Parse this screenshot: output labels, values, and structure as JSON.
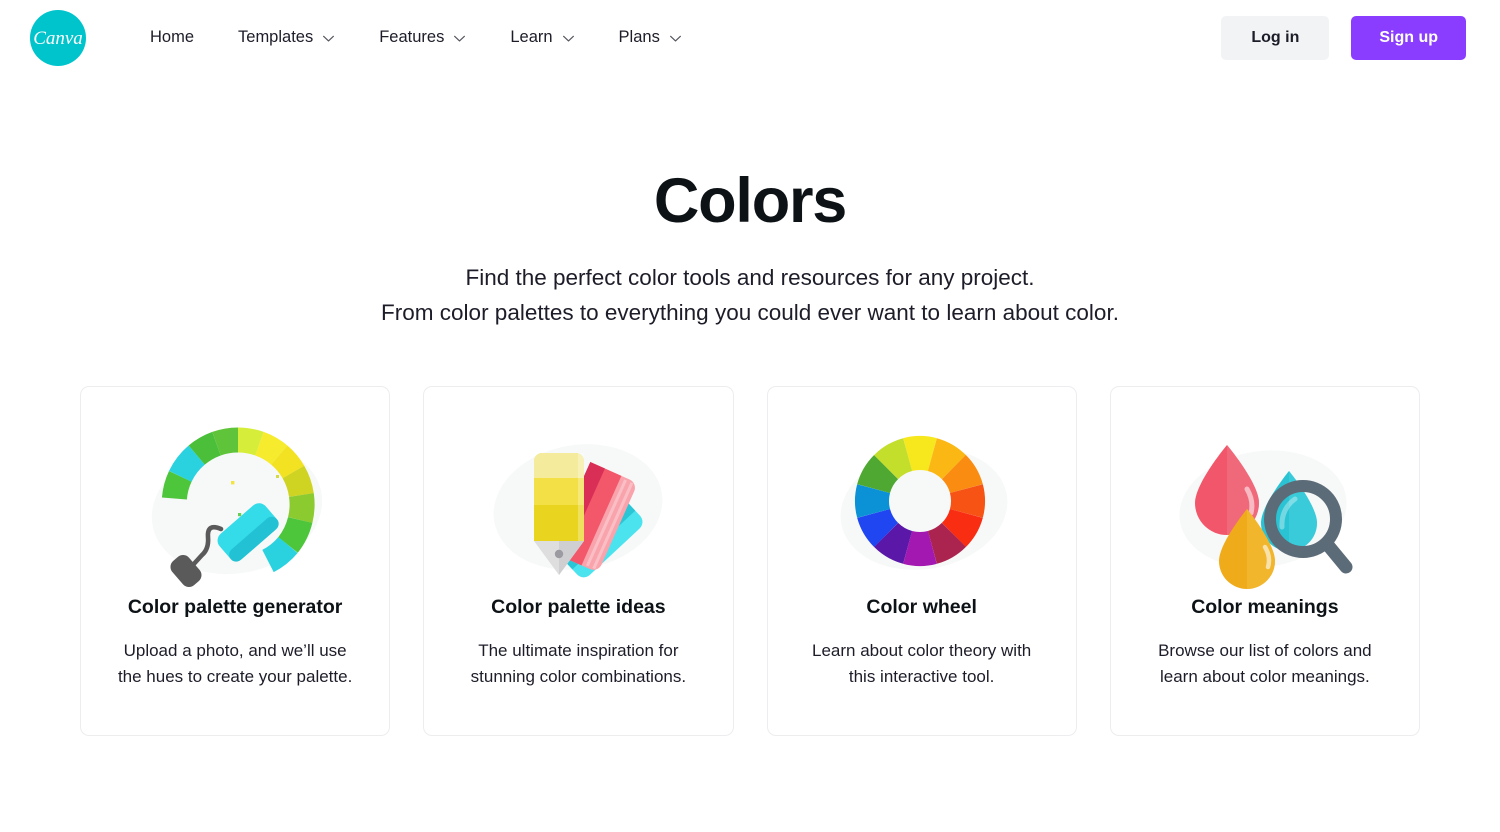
{
  "header": {
    "logo": {
      "name": "canva-logo",
      "wordmark": "Canva",
      "color": "#00c4cc"
    },
    "nav": [
      {
        "label": "Home",
        "has_dropdown": false
      },
      {
        "label": "Templates",
        "has_dropdown": true
      },
      {
        "label": "Features",
        "has_dropdown": true
      },
      {
        "label": "Learn",
        "has_dropdown": true
      },
      {
        "label": "Plans",
        "has_dropdown": true
      }
    ],
    "login_label": "Log in",
    "signup_label": "Sign up",
    "login_bg": "#f2f3f5",
    "signup_bg": "#8b3dff"
  },
  "hero": {
    "title": "Colors",
    "subtitle_line1": "Find the perfect color tools and resources for any project.",
    "subtitle_line2": "From color palettes to everything you could ever want to learn about color."
  },
  "cards": [
    {
      "icon": "paint-roller-color-arc-illustration",
      "title": "Color palette generator",
      "description": "Upload a photo, and we’ll use the hues to create your palette.",
      "arc_colors": [
        "#4ec63c",
        "#2ad2e0",
        "#4bbf3a",
        "#5fc43a",
        "#d6ee3a",
        "#f6eb2c",
        "#f2e221",
        "#cfd322",
        "#8ccb2f",
        "#4ec63c",
        "#2ad2e0"
      ],
      "roller_color": "#2ad2e0",
      "handle_color": "#5a5a5a"
    },
    {
      "icon": "color-swatch-fan-illustration",
      "title": "Color palette ideas",
      "description": "The ultimate inspiration for stunning color combinations.",
      "swatch_colors": [
        "#f5e03a",
        "#f2574f",
        "#2ad2e0"
      ],
      "tip_color": "#d8d8d8"
    },
    {
      "icon": "color-wheel-illustration",
      "title": "Color wheel",
      "description": "Learn about color theory with this interactive tool.",
      "wheel_segments": [
        "#f7e81e",
        "#fbb713",
        "#fa8c12",
        "#f65314",
        "#f92d12",
        "#ab2450",
        "#a318b0",
        "#5a17a8",
        "#1f46f0",
        "#0a91d6",
        "#4fa832",
        "#c3de2b"
      ]
    },
    {
      "icon": "color-drops-magnifier-illustration",
      "title": "Color meanings",
      "description": "Browse our list of colors and learn about color meanings.",
      "drop_colors": [
        "#f2566a",
        "#2ac3d4",
        "#efab1a"
      ],
      "magnifier_color": "#5c6b78"
    }
  ]
}
